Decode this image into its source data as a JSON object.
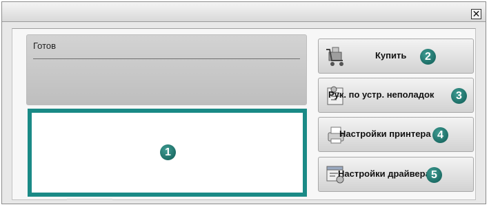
{
  "window": {
    "close_label": "✕"
  },
  "status": {
    "text": "Готов"
  },
  "callouts": {
    "image_area": "1",
    "buy": "2",
    "troubleshooting": "3",
    "printer_settings": "4",
    "driver_settings": "5"
  },
  "buttons": [
    {
      "label": "Купить",
      "icon": "shopping-cart-icon"
    },
    {
      "label": "Рук. по устр. неполадок",
      "icon": "troubleshooting-guide-icon"
    },
    {
      "label": "Настройки принтера",
      "icon": "printer-icon"
    },
    {
      "label": "Настройки драйвера",
      "icon": "driver-settings-icon"
    }
  ],
  "colors": {
    "accent": "#1a8a86",
    "callout": "#0e5a53"
  }
}
